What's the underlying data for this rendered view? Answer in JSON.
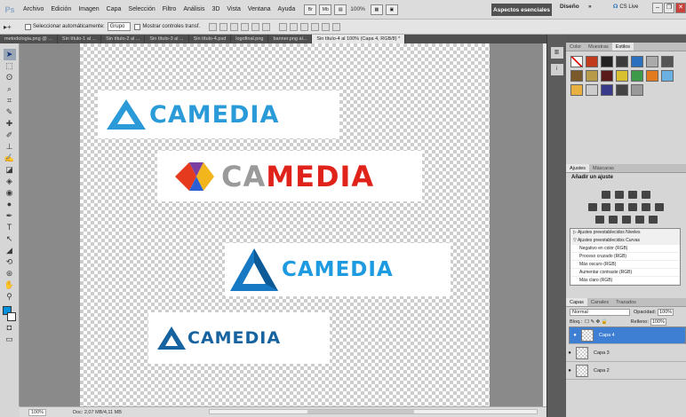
{
  "app": {
    "logo": "Ps",
    "menu": [
      "Archivo",
      "Edición",
      "Imagen",
      "Capa",
      "Selección",
      "Filtro",
      "Análisis",
      "3D",
      "Vista",
      "Ventana",
      "Ayuda"
    ],
    "zoom": "100%",
    "workspace": "Aspectos esenciales",
    "design": "Diseño",
    "more": "»",
    "cslive": "CS Live"
  },
  "options": {
    "auto_select_label": "Seleccionar automáticamente:",
    "auto_select_value": "Grupo",
    "transform_label": "Mostrar controles transf."
  },
  "tabs": [
    "metodologia.png @ ...",
    "Sin título-1 al ...",
    "Sin título-2 al ...",
    "Sin título-3 al ...",
    "Sin título-4.psd",
    "logofinal.png",
    "banner.png al...",
    "Sin título-4 al 100% (Capa 4, RGB/8) *"
  ],
  "canvas": {
    "logos": [
      "CAMEDIA",
      "CA",
      "MEDIA",
      "CAMEDIA",
      "CAMEDIA"
    ]
  },
  "status": {
    "zoom": "100%",
    "doc": "Doc: 2,07 MB/4,11 MB"
  },
  "panels": {
    "styles_tabs": [
      "Color",
      "Muestras",
      "Estilos"
    ],
    "adjust_tabs": [
      "Ajustes",
      "Máscaras"
    ],
    "adjust_title": "Añadir un ajuste",
    "presets": [
      "Ajustes preestablecidos Niveles",
      "Ajustes preestablecidos Curvas",
      "Negativo en color (RGB)",
      "Proceso cruzado (RGB)",
      "Más oscuro (RGB)",
      "Aumentar contraste (RGB)",
      "Más claro (RGB)"
    ],
    "layers_tabs": [
      "Capas",
      "Canales",
      "Trazados"
    ],
    "blend": "Normal",
    "opacity_label": "Opacidad:",
    "opacity": "100%",
    "lock_label": "Bloq.:",
    "fill_label": "Relleno:",
    "fill": "100%",
    "layers": [
      "Capa 4",
      "Capa 3",
      "Capa 2"
    ]
  },
  "colors": {
    "accent_blue": "#0091e0",
    "selection": "#3e7fd3"
  }
}
